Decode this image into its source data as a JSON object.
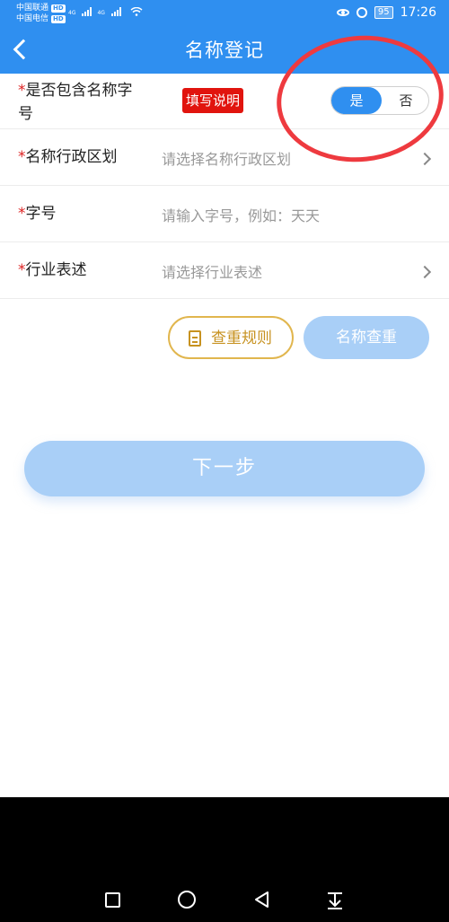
{
  "status": {
    "carrier1": "中国联通",
    "carrier2": "中国电信",
    "hd_badge": "HD",
    "network": "4G",
    "battery": "95",
    "time": "17:26"
  },
  "header": {
    "title": "名称登记"
  },
  "form": {
    "include_name": {
      "label_star": "*",
      "label": "是否包含名称字号",
      "fill_tag": "填写说明",
      "option_yes": "是",
      "option_no": "否",
      "selected": "是"
    },
    "region": {
      "label_star": "*",
      "label": "名称行政区划",
      "placeholder": "请选择名称行政区划"
    },
    "trade_name": {
      "label_star": "*",
      "label": "字号",
      "placeholder": "请输入字号，例如：天天"
    },
    "industry": {
      "label_star": "*",
      "label": "行业表述",
      "placeholder": "请选择行业表述"
    }
  },
  "actions": {
    "rule_label": "查重规则",
    "check_label": "名称查重",
    "next_label": "下一步"
  },
  "colors": {
    "primary": "#2f8ff0",
    "disabled_button": "#a9cff7",
    "tag_red": "#e1140e",
    "rule_gold": "#c79220",
    "annotation": "#ee3a3f"
  }
}
